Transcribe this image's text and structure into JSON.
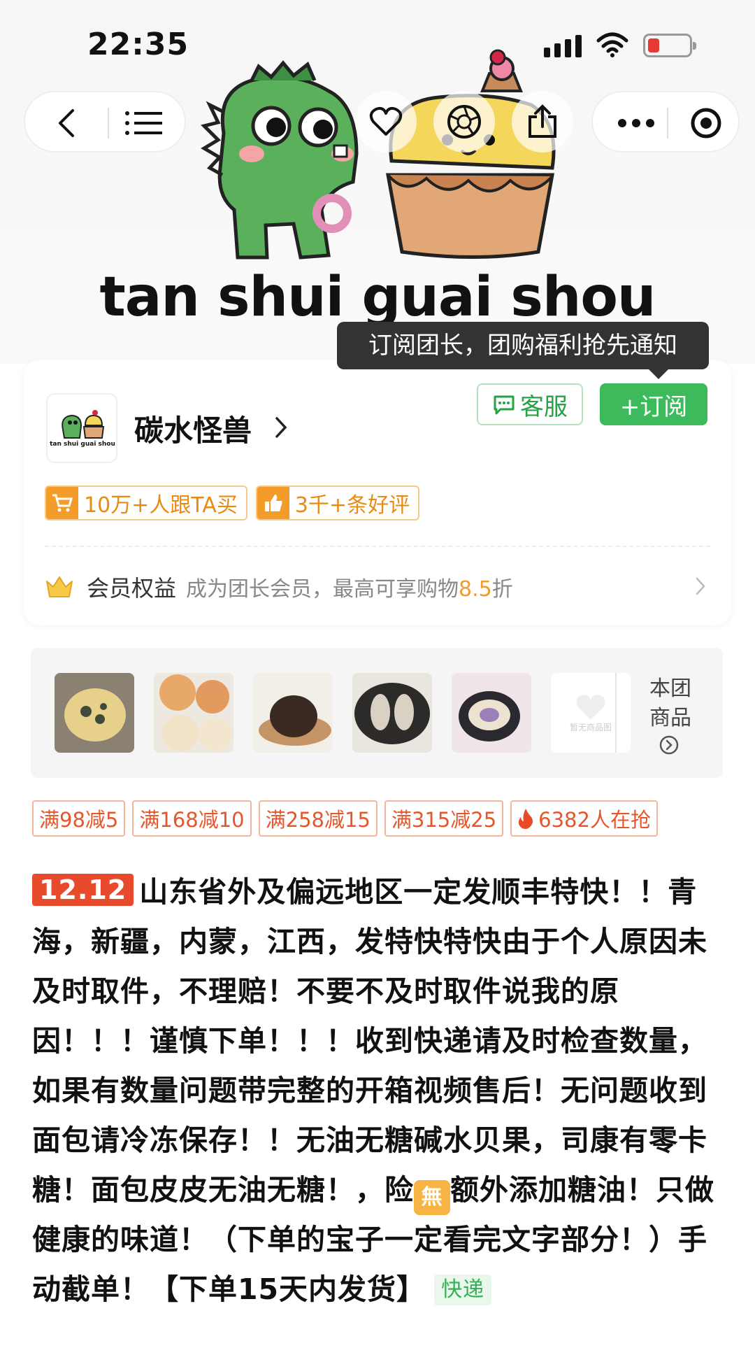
{
  "status_bar": {
    "time": "22:35"
  },
  "banner": {
    "brand_text": "tan shui guai shou",
    "logo_text": "tan shui guai shou"
  },
  "nav": {
    "icons": [
      "back-icon",
      "menu-icon",
      "heart-icon",
      "shutter-icon",
      "share-icon",
      "more-icon",
      "target-icon"
    ]
  },
  "tooltip": {
    "text": "订阅团长，团购福利抢先通知"
  },
  "store": {
    "name": "碳水怪兽",
    "service_label": "客服",
    "subscribe_label": "+订阅",
    "badges": [
      {
        "text": "10万+人跟TA买",
        "icon": "cart-icon"
      },
      {
        "text": "3千+条好评",
        "icon": "thumbs-up-icon"
      }
    ],
    "member_title": "会员权益",
    "member_desc_prefix": "成为团长会员，最高可享购物",
    "member_discount": "8.5",
    "member_desc_suffix": "折"
  },
  "product_strip": {
    "placeholder_text": "暂无商品图",
    "more_line1": "本团",
    "more_line2": "商品"
  },
  "coupons": [
    "满98减5",
    "满168减10",
    "满258减15",
    "满315减25"
  ],
  "hot": "6382人在抢",
  "description": {
    "tag": "12.12",
    "text_before": "山东省外及偏远地区一定发顺丰特快！！青海，新疆，内蒙，江西，发特快特快由于个人原因未及时取件，不理赔！不要不及时取件说我的原因！！！谨慎下单！！！收到快递请及时检查数量，如果有数量问题带完整的开箱视频售后！无问题收到面包请冷冻保存！！无油无糖碱水贝果，司康有零卡糖！面包皮皮无油无糖！，险",
    "badge": "無",
    "text_after": "额外添加糖油！只做健康的味道！（下单的宝子一定看完文字部分！）手动截单！【下单15天内发货】",
    "express_tag": "快递"
  },
  "colors": {
    "green": "#3cba5c",
    "orange": "#f49c2a",
    "red": "#e84b2c",
    "battery_low": "#e53935"
  },
  "battery_level": 0.28
}
